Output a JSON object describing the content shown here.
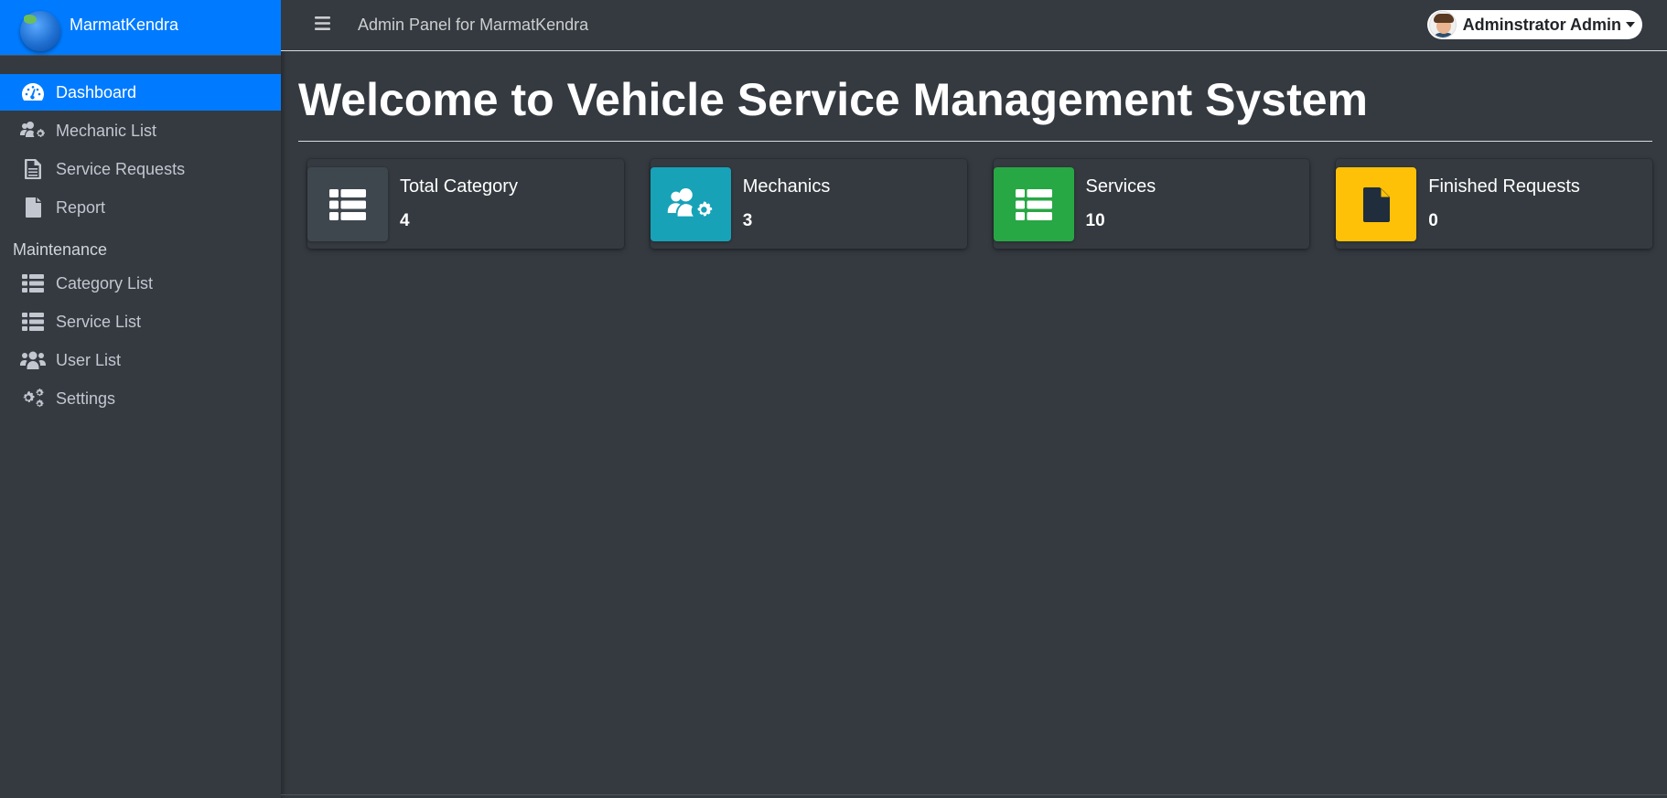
{
  "brand": {
    "name": "MarmatKendra"
  },
  "sidebar": {
    "items": [
      {
        "label": "Dashboard",
        "icon": "tachometer-icon",
        "active": true
      },
      {
        "label": "Mechanic List",
        "icon": "users-cog-icon"
      },
      {
        "label": "Service Requests",
        "icon": "file-alt-icon"
      },
      {
        "label": "Report",
        "icon": "file-icon"
      }
    ],
    "section_header": "Maintenance",
    "maintenance_items": [
      {
        "label": "Category List",
        "icon": "th-list-icon"
      },
      {
        "label": "Service List",
        "icon": "th-list-icon"
      },
      {
        "label": "User List",
        "icon": "users-icon"
      },
      {
        "label": "Settings",
        "icon": "cogs-icon"
      }
    ]
  },
  "topbar": {
    "title": "Admin Panel for MarmatKendra",
    "user_name": "Adminstrator Admin"
  },
  "main": {
    "heading": "Welcome to Vehicle Service Management System",
    "cards": [
      {
        "label": "Total Category",
        "value": "4",
        "color": "#3f474e",
        "icon": "th-list-icon"
      },
      {
        "label": "Mechanics",
        "value": "3",
        "color": "#17a2b8",
        "icon": "users-cog-icon"
      },
      {
        "label": "Services",
        "value": "10",
        "color": "#28a745",
        "icon": "th-list-icon"
      },
      {
        "label": "Finished Requests",
        "value": "0",
        "color": "#ffc107",
        "icon": "file-invoice-icon"
      }
    ]
  },
  "colors": {
    "accent": "#007bff",
    "background": "#343a40",
    "sidebar_text": "#c2c7d0"
  }
}
